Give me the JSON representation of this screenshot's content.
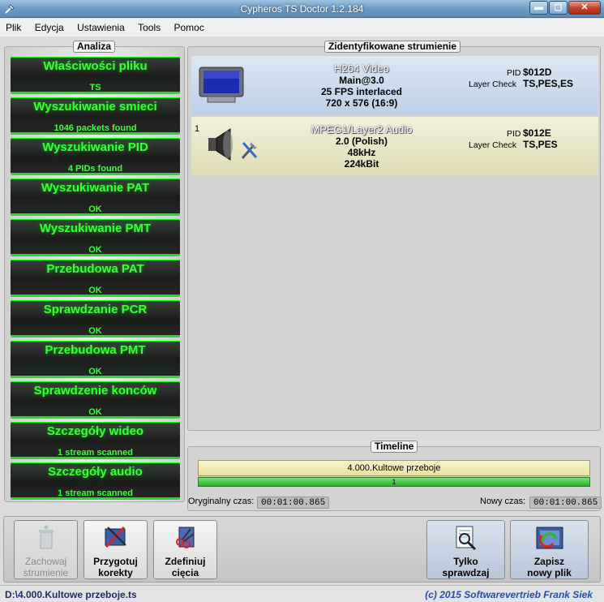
{
  "window": {
    "title": "Cypheros TS Doctor 1.2.184"
  },
  "menu": [
    "Plik",
    "Edycja",
    "Ustawienia",
    "Tools",
    "Pomoc"
  ],
  "analysis": {
    "label": "Analiza",
    "steps": [
      {
        "title": "Właściwości pliku",
        "status": "TS"
      },
      {
        "title": "Wyszukiwanie smieci",
        "status": "1046 packets found"
      },
      {
        "title": "Wyszukiwanie PID",
        "status": "4 PIDs found"
      },
      {
        "title": "Wyszukiwanie PAT",
        "status": "OK"
      },
      {
        "title": "Wyszukiwanie PMT",
        "status": "OK"
      },
      {
        "title": "Przebudowa PAT",
        "status": "OK"
      },
      {
        "title": "Sprawdzanie PCR",
        "status": "OK"
      },
      {
        "title": "Przebudowa PMT",
        "status": "OK"
      },
      {
        "title": "Sprawdzenie konców",
        "status": "OK"
      },
      {
        "title": "Szczegóły wideo",
        "status": "1 stream scanned"
      },
      {
        "title": "Szczegóły audio",
        "status": "1 stream scanned"
      }
    ]
  },
  "streams": {
    "label": "Zidentyfikowane strumienie",
    "pid_key": "PID",
    "check_key": "Layer Check",
    "items": [
      {
        "index": "",
        "codec": "H264 Video",
        "lines": [
          "Main@3.0",
          "25 FPS interlaced",
          "720 x 576 (16:9)"
        ],
        "pid": "$012D",
        "check": "TS,PES,ES",
        "icon": "tv-icon"
      },
      {
        "index": "1",
        "codec": "MPEG1/Layer2 Audio",
        "lines": [
          "2.0 (Polish)",
          "48kHz",
          "224kBit"
        ],
        "pid": "$012E",
        "check": "TS,PES",
        "icon": "speaker-icon"
      }
    ]
  },
  "timeline": {
    "label": "Timeline",
    "segment_name": "4.000.Kultowe przeboje",
    "segment_number": "1",
    "original_label": "Oryginalny czas:",
    "original_time": "00:01:00.865",
    "new_label": "Nowy czas:",
    "new_time": "00:01:00.865"
  },
  "toolbar": {
    "save_stream": [
      "Zachowaj",
      "strumienie"
    ],
    "prepare": [
      "Przygotuj",
      "korekty"
    ],
    "define_cuts": [
      "Zdefiniuj",
      "cięcia"
    ],
    "check_only": [
      "Tylko",
      "sprawdzaj"
    ],
    "save_new": [
      "Zapisz",
      "nowy plik"
    ]
  },
  "status": {
    "path": "D:\\4.000.Kultowe przeboje.ts",
    "copyright": "(c) 2015 Softwarevertrieb Frank Siek"
  },
  "colors": {
    "step_green": "#39ff39",
    "stream1_bg": "#c7d6ea",
    "stream2_bg": "#e9e7c9",
    "copyright": "#1e4fb8"
  }
}
